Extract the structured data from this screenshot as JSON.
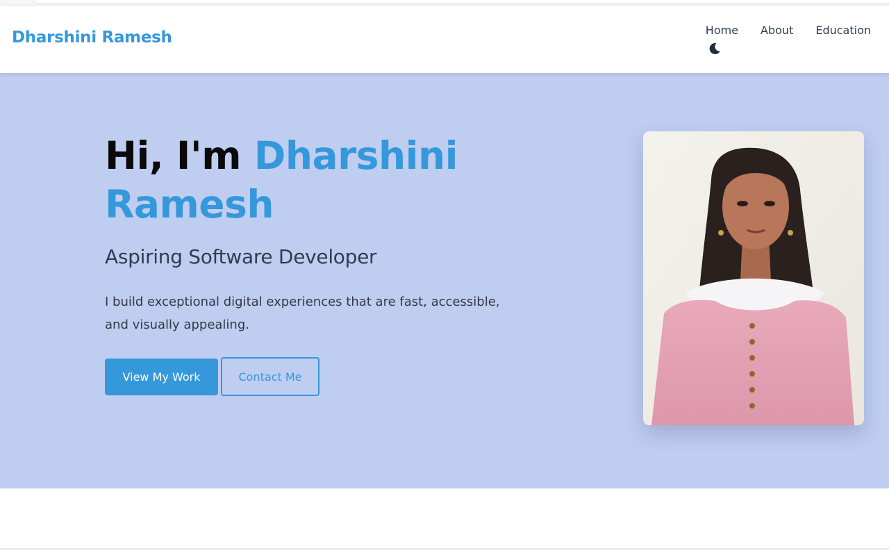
{
  "brand": {
    "name": "Dharshini Ramesh"
  },
  "nav": {
    "links": [
      {
        "label": "Home"
      },
      {
        "label": "About"
      },
      {
        "label": "Education"
      }
    ],
    "theme_toggle_icon": "moon-icon"
  },
  "hero": {
    "greeting": "Hi, I'm ",
    "name": "Dharshini Ramesh",
    "subtitle": "Aspiring Software Developer",
    "description": "I build exceptional digital experiences that are fast, accessible, and visually appealing.",
    "primary_button": "View My Work",
    "secondary_button": "Contact Me",
    "photo_alt": "Dharshini Ramesh"
  },
  "colors": {
    "accent": "#3498db",
    "hero_background": "#bfcdf1",
    "nav_text": "#2c3e50"
  }
}
